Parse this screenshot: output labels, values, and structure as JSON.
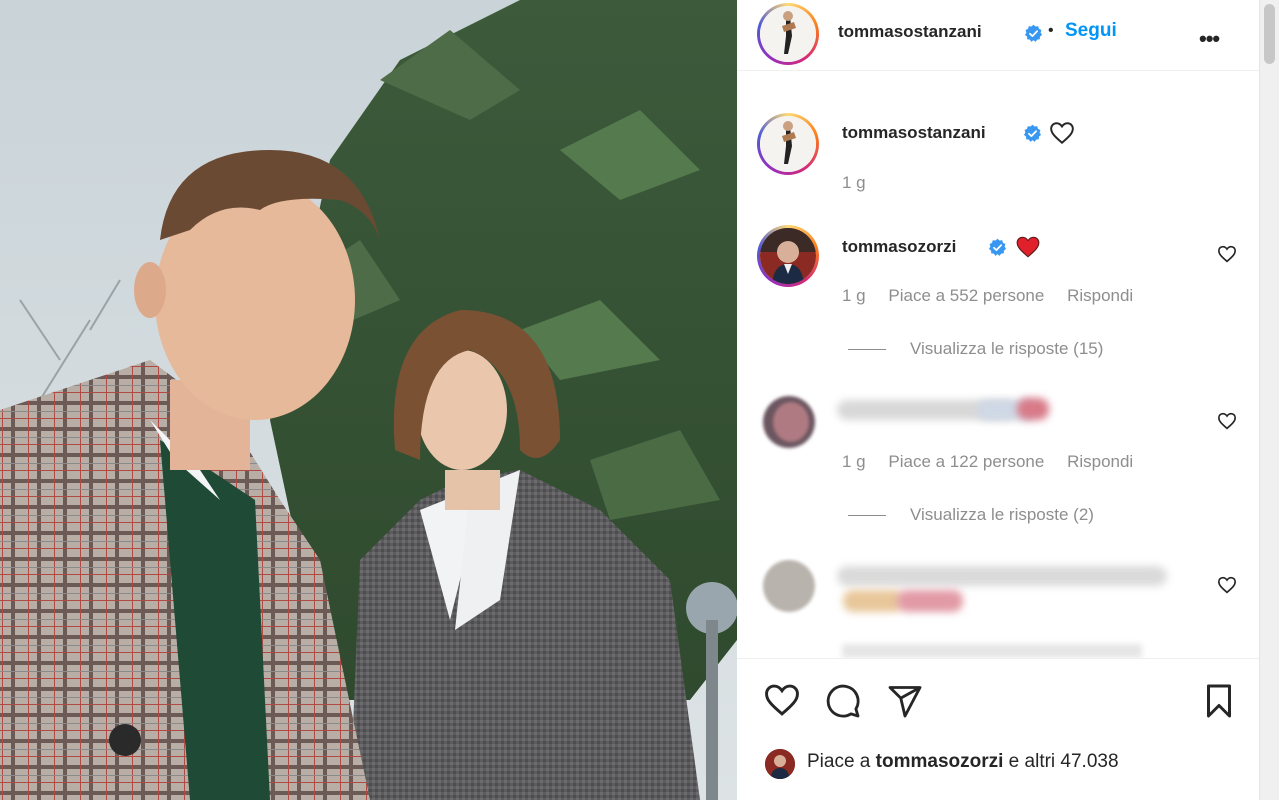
{
  "post": {
    "author": "tommasostanzani",
    "follow_label": "Segui",
    "separator": "•",
    "more_label": "•••",
    "caption_time": "1 g"
  },
  "comments": [
    {
      "username": "tommasozorzi",
      "emoji": "❤️",
      "time": "1 g",
      "likes": "Piace a 552 persone",
      "reply_label": "Rispondi",
      "view_replies": "Visualizza le risposte (15)"
    },
    {
      "username": "",
      "time": "1 g",
      "likes": "Piace a 122 persone",
      "reply_label": "Rispondi",
      "view_replies": "Visualizza le risposte (2)"
    },
    {
      "username": ""
    }
  ],
  "footer": {
    "liked_prefix": "Piace a ",
    "liked_user": "tommasozorzi",
    "liked_suffix": " e altri 47.038"
  },
  "icons": {
    "like": "heart-icon",
    "comment": "comment-icon",
    "share": "share-icon",
    "save": "bookmark-icon",
    "verified": "verified-badge-icon"
  },
  "colors": {
    "accent": "#0095f6",
    "verified": "#3897f0",
    "heart_red": "#ed4956",
    "meta": "#8e8e8e"
  }
}
